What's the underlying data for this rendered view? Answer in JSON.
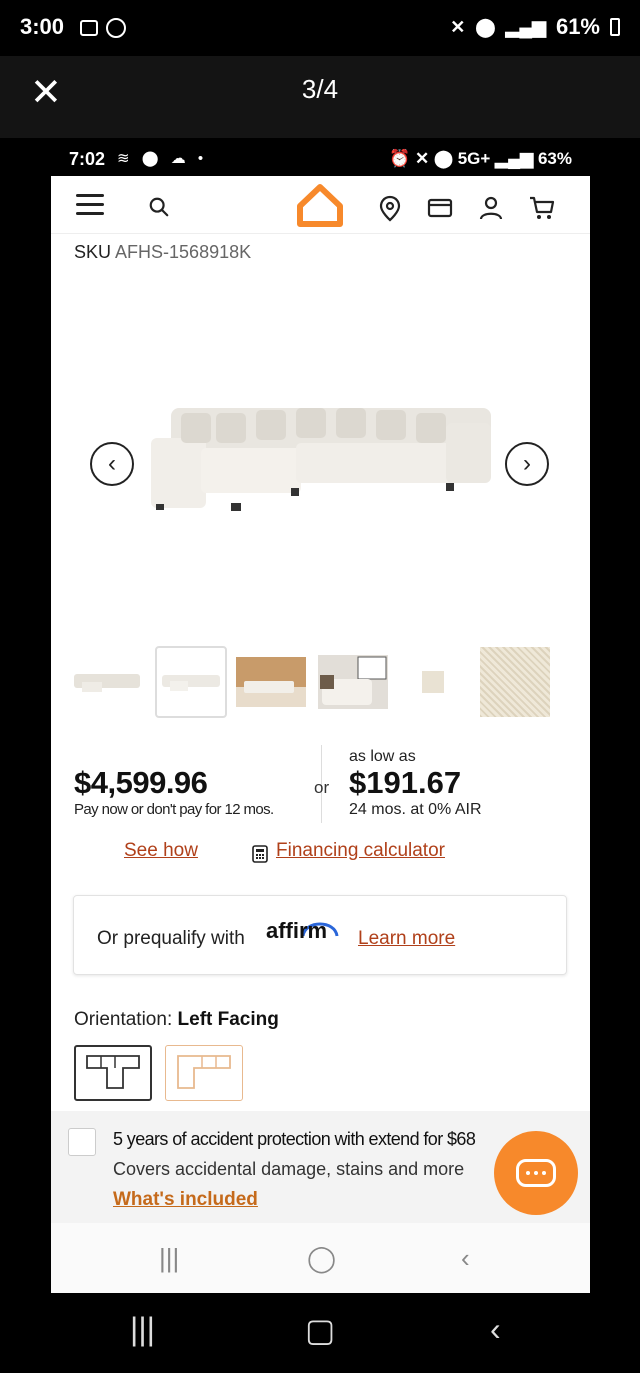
{
  "outer_status": {
    "time": "3:00",
    "battery": "61%"
  },
  "viewer": {
    "counter": "3/4"
  },
  "inner_status": {
    "time": "7:02",
    "network": "5G+",
    "battery": "63%"
  },
  "product": {
    "sku_label": "SKU",
    "sku_value": "AFHS-1568918K",
    "price": "$4,599.96",
    "pay_note": "Pay now or don't pay for 12 mos.",
    "or": "or",
    "as_low_as": "as low as",
    "monthly_price": "$191.67",
    "terms": "24 mos. at 0% AIR",
    "see_how": "See how",
    "financing_calculator": "Financing calculator"
  },
  "affirm": {
    "text": "Or prequalify with",
    "logo": "affirm",
    "learn_more": "Learn more"
  },
  "orientation": {
    "label": "Orientation:",
    "value": "Left Facing"
  },
  "protection": {
    "title": "5 years of accident protection with extend for $68",
    "subtitle": "Covers accidental damage, stains and more",
    "whats_included": "What's included"
  },
  "colors": {
    "brand_orange": "#f7892b",
    "link_red": "#b0401a",
    "link_orange": "#c56a1b"
  }
}
